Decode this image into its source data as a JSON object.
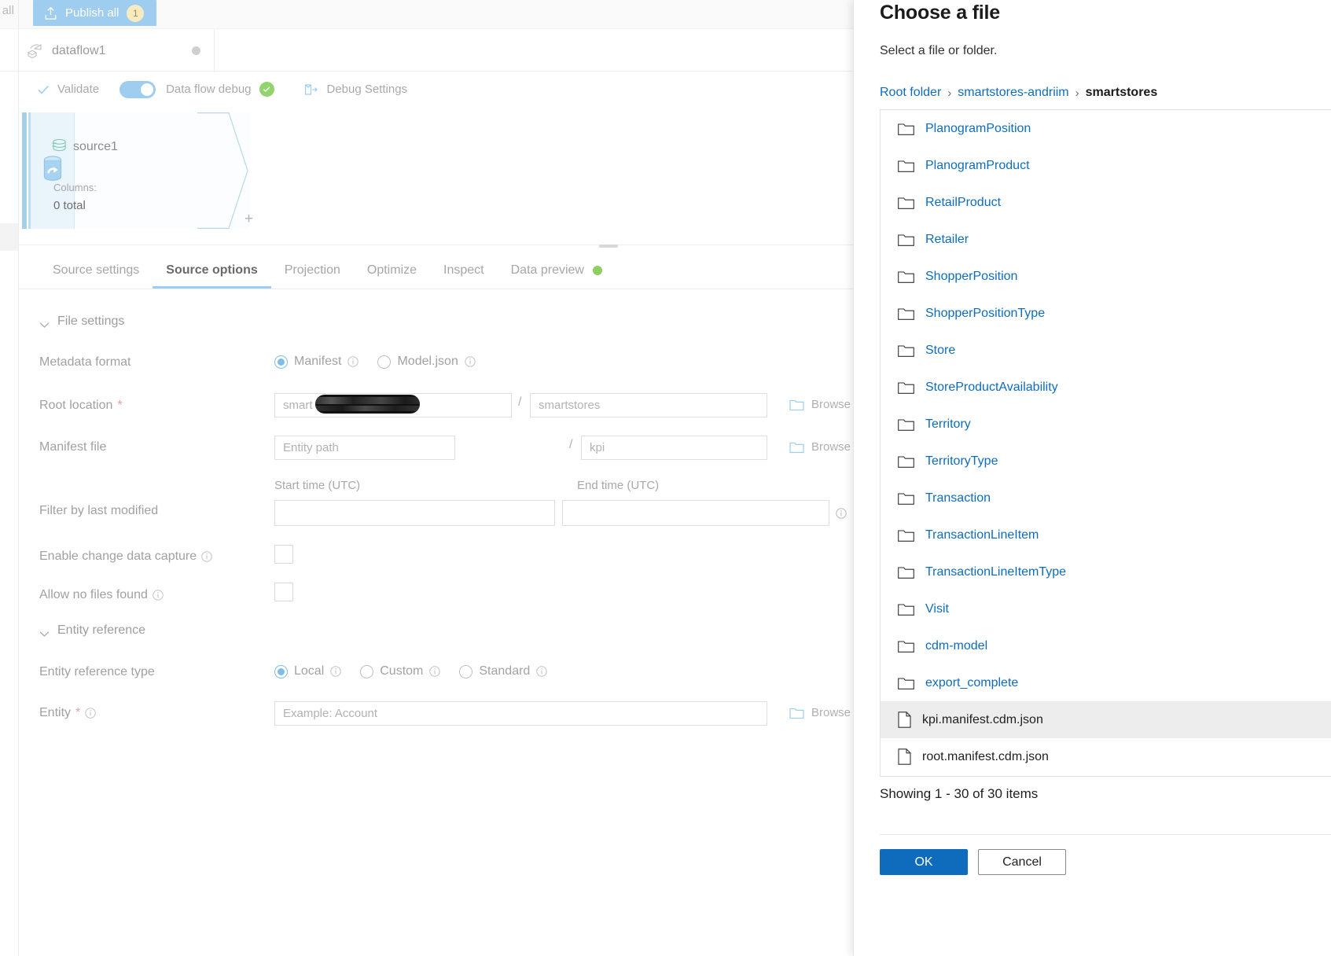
{
  "toolbar": {
    "save_all_fragment": "e all",
    "publish_all_label": "Publish all",
    "publish_all_count": "1",
    "publish_icon": "publish-upload-icon"
  },
  "dataflow_bar": {
    "name": "dataflow1",
    "icon": "dataflow-icon",
    "status_dot": "unsaved-dot"
  },
  "debug_bar": {
    "validate_label": "Validate",
    "validate_icon": "checkmark-icon",
    "debug_toggle_label": "Data flow debug",
    "debug_toggle_on": true,
    "debug_status_icon": "success-check-icon",
    "debug_settings_label": "Debug Settings",
    "debug_settings_icon": "debug-settings-icon"
  },
  "canvas": {
    "node": {
      "title": "source1",
      "title_icon": "dataset-icon",
      "source_icon": "source-stream-icon",
      "columns_label": "Columns:",
      "columns_value": "0 total",
      "add_label": "+"
    }
  },
  "tabs": [
    {
      "label": "Source settings",
      "active": false
    },
    {
      "label": "Source options",
      "active": true
    },
    {
      "label": "Projection",
      "active": false
    },
    {
      "label": "Optimize",
      "active": false
    },
    {
      "label": "Inspect",
      "active": false
    },
    {
      "label": "Data preview",
      "active": false,
      "status_dot": "#8cd05f"
    }
  ],
  "form": {
    "file_settings_section": "File settings",
    "entity_reference_section": "Entity reference",
    "metadata_format": {
      "label": "Metadata format",
      "options": [
        {
          "label": "Manifest",
          "selected": true
        },
        {
          "label": "Model.json",
          "selected": false
        }
      ]
    },
    "root_location": {
      "label": "Root location",
      "required": true,
      "container_value": "smart",
      "container_redacted": true,
      "separator": "/",
      "folder_value": "smartstores",
      "browse_label": "Browse"
    },
    "manifest_file": {
      "label": "Manifest file",
      "entity_path_placeholder": "Entity path",
      "separator": "/",
      "file_value": "kpi",
      "browse_label": "Browse"
    },
    "filter_by_last_modified": {
      "label": "Filter by last modified",
      "start_time_label": "Start time (UTC)",
      "end_time_label": "End time (UTC)",
      "start_time_value": "",
      "end_time_value": ""
    },
    "enable_change_data_capture": {
      "label": "Enable change data capture",
      "checked": false
    },
    "allow_no_files_found": {
      "label": "Allow no files found",
      "checked": false
    },
    "entity_reference_type": {
      "label": "Entity reference type",
      "options": [
        {
          "label": "Local",
          "selected": true
        },
        {
          "label": "Custom",
          "selected": false
        },
        {
          "label": "Standard",
          "selected": false
        }
      ]
    },
    "entity": {
      "label": "Entity",
      "required": true,
      "placeholder": "Example: Account",
      "value": "",
      "browse_label": "Browse"
    }
  },
  "modal": {
    "title": "Choose a file",
    "subtitle": "Select a file or folder.",
    "breadcrumb": [
      {
        "label": "Root folder",
        "current": false
      },
      {
        "label": "smartstores-andriim",
        "current": false
      },
      {
        "label": "smartstores",
        "current": true
      }
    ],
    "breadcrumb_separator": "›",
    "items": [
      {
        "name": "PlanogramPosition",
        "type": "folder",
        "selected": false
      },
      {
        "name": "PlanogramProduct",
        "type": "folder",
        "selected": false
      },
      {
        "name": "RetailProduct",
        "type": "folder",
        "selected": false
      },
      {
        "name": "Retailer",
        "type": "folder",
        "selected": false
      },
      {
        "name": "ShopperPosition",
        "type": "folder",
        "selected": false
      },
      {
        "name": "ShopperPositionType",
        "type": "folder",
        "selected": false
      },
      {
        "name": "Store",
        "type": "folder",
        "selected": false
      },
      {
        "name": "StoreProductAvailability",
        "type": "folder",
        "selected": false
      },
      {
        "name": "Territory",
        "type": "folder",
        "selected": false
      },
      {
        "name": "TerritoryType",
        "type": "folder",
        "selected": false
      },
      {
        "name": "Transaction",
        "type": "folder",
        "selected": false
      },
      {
        "name": "TransactionLineItem",
        "type": "folder",
        "selected": false
      },
      {
        "name": "TransactionLineItemType",
        "type": "folder",
        "selected": false
      },
      {
        "name": "Visit",
        "type": "folder",
        "selected": false
      },
      {
        "name": "cdm-model",
        "type": "folder",
        "selected": false
      },
      {
        "name": "export_complete",
        "type": "folder",
        "selected": false
      },
      {
        "name": "kpi.manifest.cdm.json",
        "type": "file",
        "selected": true
      },
      {
        "name": "root.manifest.cdm.json",
        "type": "file",
        "selected": false
      }
    ],
    "showing_text": "Showing 1 - 30 of 30 items",
    "ok_label": "OK",
    "cancel_label": "Cancel"
  },
  "colors": {
    "accent_blue": "#0f6cbd",
    "link_blue": "#0f6cbd",
    "dimmed_blue": "#9ecdf0",
    "success_green": "#8cd05f",
    "selected_row": "#ededed",
    "required_star": "#e8a1a1"
  }
}
